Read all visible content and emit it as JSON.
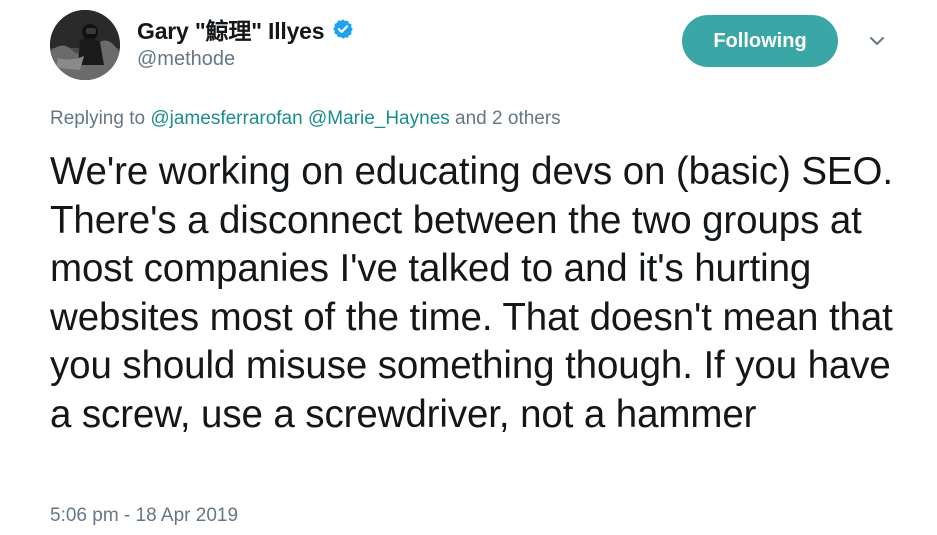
{
  "author": {
    "display_name": "Gary \"鯨理\" Illyes",
    "handle": "@methode",
    "verified": true
  },
  "follow_button": {
    "label": "Following"
  },
  "reply": {
    "prefix": "Replying to",
    "mentions": [
      "@jamesferrarofan",
      "@Marie_Haynes"
    ],
    "suffix": "and 2 others"
  },
  "tweet": {
    "text": "We're working on educating devs on (basic) SEO. There's a disconnect between the two groups at most companies I've talked to and it's hurting websites most of the time. That doesn't mean that you should misuse something though. If you have a screw, use a screwdriver, not a hammer",
    "timestamp": "5:06 pm - 18 Apr 2019"
  },
  "colors": {
    "accent": "#3ba6a6",
    "mention": "#1b8d8d",
    "secondary_text": "#657786",
    "verified_badge": "#1da1f2"
  },
  "icons": {
    "verified": "verified-badge-icon",
    "menu": "chevron-down-icon"
  }
}
